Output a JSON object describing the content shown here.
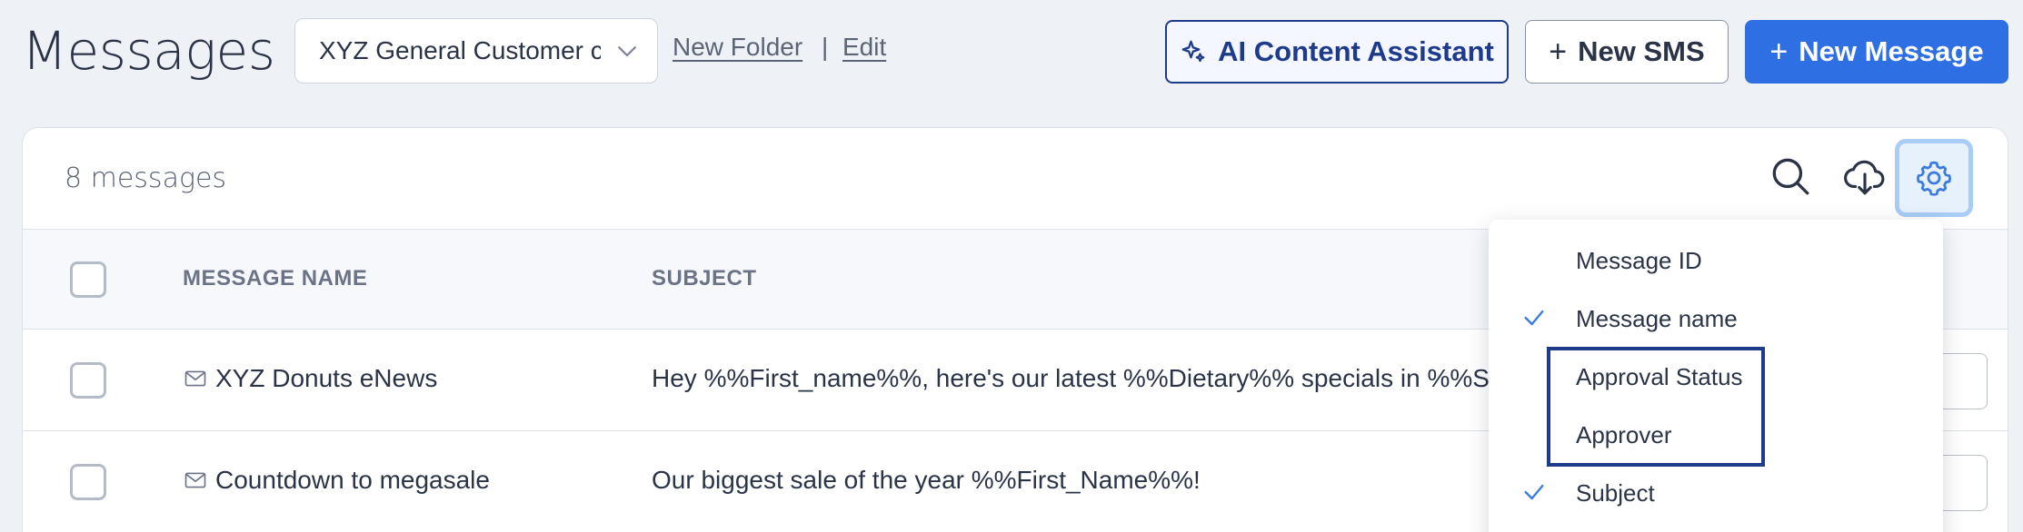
{
  "header": {
    "title": "Messages",
    "folder_select_value": "XYZ General Customer co",
    "new_folder_link": "New Folder",
    "separator": "|",
    "edit_link": "Edit",
    "ai_button": "AI Content Assistant",
    "new_sms_button": "New SMS",
    "new_message_button": "New Message",
    "plus": "+"
  },
  "toolbar": {
    "message_count": "8 messages",
    "icons": [
      "search-icon",
      "cloud-download-icon",
      "gear-icon"
    ]
  },
  "table": {
    "columns": [
      "MESSAGE NAME",
      "SUBJECT"
    ],
    "rows": [
      {
        "name": "XYZ Donuts eNews",
        "subject": "Hey %%First_name%%, here's our latest %%Dietary%% specials in %%State%%"
      },
      {
        "name": "Countdown to megasale",
        "subject": "Our biggest sale of the year %%First_Name%%!"
      }
    ]
  },
  "column_menu": {
    "items": [
      {
        "label": "Message ID",
        "checked": false
      },
      {
        "label": "Message name",
        "checked": true
      },
      {
        "label": "Approval Status",
        "checked": false
      },
      {
        "label": "Approver",
        "checked": false
      },
      {
        "label": "Subject",
        "checked": true
      }
    ]
  },
  "colors": {
    "primary": "#2f6fe4",
    "navy": "#1e3a8a",
    "check": "#3b7be0",
    "background": "#eef1f6"
  }
}
